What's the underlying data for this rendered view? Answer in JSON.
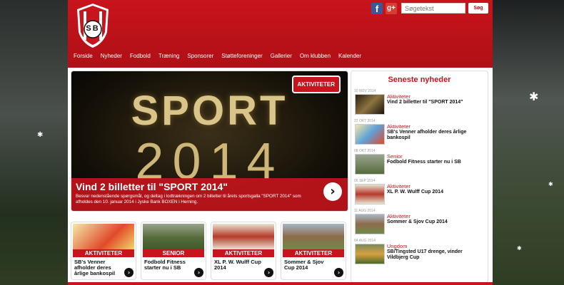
{
  "site": {
    "logo_text": "SB",
    "search_placeholder": "Søgetekst",
    "search_button": "Søg",
    "social": {
      "facebook": "f",
      "googleplus": "g+"
    },
    "nav": [
      "Forside",
      "Nyheder",
      "Fodbold",
      "Træning",
      "Sponsorer",
      "Støtteforeninger",
      "Gallerier",
      "Om klubben",
      "Kalender"
    ]
  },
  "slider": {
    "badge": "AKTIVITETER",
    "headline_art": "SPORT",
    "year_art": "2014",
    "title": "Vind 2 billetter til \"SPORT 2014\"",
    "text": "Besvar nedenstående spørgsmål, og deltag i lodtrækningen om 2 billetter til årets sportsgalla \"SPORT 2014\" som afholdes den 10. januar 2014 i Jyske Bank BOXEN i Herning."
  },
  "cards": [
    {
      "category": "AKTIVITETER",
      "title": "SB's Venner afholder deres årlige bankospil"
    },
    {
      "category": "SENIOR",
      "title": "Fodbold Fitness starter nu i SB"
    },
    {
      "category": "AKTIVITETER",
      "title": "XL P. W. Wulff Cup 2014"
    },
    {
      "category": "AKTIVITETER",
      "title": "Sommer & Sjov Cup 2014"
    }
  ],
  "news": {
    "heading": "Seneste nyheder",
    "items": [
      {
        "date": "10 NOV 2014",
        "category": "Aktiviteter",
        "title": "Vind 2 billetter til \"SPORT 2014\""
      },
      {
        "date": "22 OKT 2014",
        "category": "Aktiviteter",
        "title": "SB's Venner afholder deres årlige bankospil"
      },
      {
        "date": "08 OKT 2014",
        "category": "Senior",
        "title": "Fodbold Fitness starter nu i SB"
      },
      {
        "date": "06 SEP 2014",
        "category": "Aktiviteter",
        "title": "XL P. W. Wulff Cup 2014"
      },
      {
        "date": "11 AUG 2014",
        "category": "Aktiviteter",
        "title": "Sommer & Sjov Cup 2014"
      },
      {
        "date": "04 AUG 2014",
        "category": "Ungdom",
        "title": "SB/Tingsted U17 drenge, vinder Vildbjerg Cup"
      }
    ]
  },
  "colors": {
    "brand_red": "#c8141c",
    "header_red": "#b10f16"
  }
}
